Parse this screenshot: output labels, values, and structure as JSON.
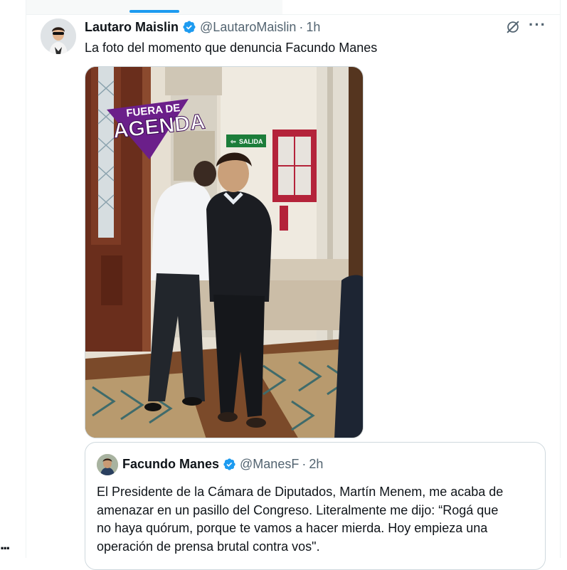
{
  "tweet": {
    "author_name": "Lautaro Maislin",
    "author_handle": "@LautaroMaislin",
    "separator": "·",
    "time": "1h",
    "text": "La foto del momento que denuncia Facundo Manes",
    "image": {
      "overlay_line1": "FUERA DE",
      "overlay_line2": "AGENDA",
      "exit_sign": "SALIDA"
    }
  },
  "quoted_tweet": {
    "author_name": "Facundo Manes",
    "author_handle": "@ManesF",
    "separator": "·",
    "time": "2h",
    "text_lines": [
      "El Presidente de la Cámara de Diputados, Martín Menem, me acaba de",
      "amenazar en un pasillo del Congreso. Literalmente me dijo: “Rogá que",
      "no haya quórum, porque te vamos a hacer mierda. Hoy empieza una",
      "operación de prensa brutal contra vos\"."
    ]
  },
  "left_rail": {
    "dots": "..."
  },
  "icons": {
    "verified": "verified-badge-icon",
    "grok": "grok-icon",
    "more": "more-options-icon"
  },
  "colors": {
    "accent": "#1d9bf0",
    "text_primary": "#0f1419",
    "text_secondary": "#536471",
    "border": "#cfd9de",
    "overlay_purple": "#6b1f8a"
  }
}
